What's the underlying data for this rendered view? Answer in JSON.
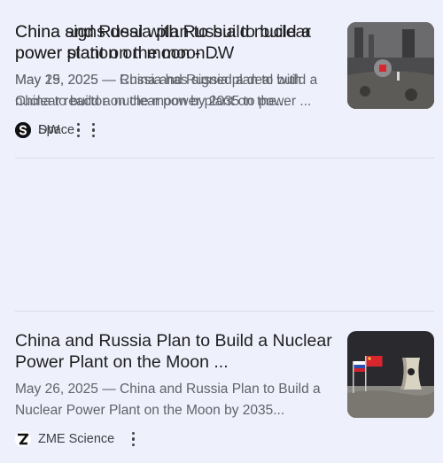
{
  "results": [
    {
      "title_line1": "China and Russia plan to build nuclear",
      "title_line2": "power station on moon - DW",
      "snippet_line1": "May 19, 2025 — China and Russia plan to build a",
      "snippet_line2": "nuclear reactor on the moon by 2035 to power ...",
      "source": "DW",
      "favicon_icon": "dw-logo-icon",
      "thumbnail_icon": "lunar-surface-station-image"
    },
    {
      "title_line1": "China and Russia Plan to Build a Nuclear",
      "title_line2": "Power Plant on the Moon ...",
      "snippet_line1": "May 26, 2025 — China and Russia Plan to Build a",
      "snippet_line2": "Nuclear Power Plant on the Moon by 2035...",
      "source": "ZME Science",
      "favicon_icon": "zme-logo-icon",
      "thumbnail_icon": "flags-nuclear-plant-moon-image"
    },
    {
      "title_line1": "China signs deal with Russia to build a",
      "title_line2": "power plant on the moon ...",
      "snippet_line1": "May 25, 2025 — Russia has signed a deal with",
      "snippet_line2": "China to build a nuclear power plant on the...",
      "source": "Space",
      "favicon_icon": "space-logo-icon",
      "thumbnail_icon": "moon-base-image"
    }
  ]
}
